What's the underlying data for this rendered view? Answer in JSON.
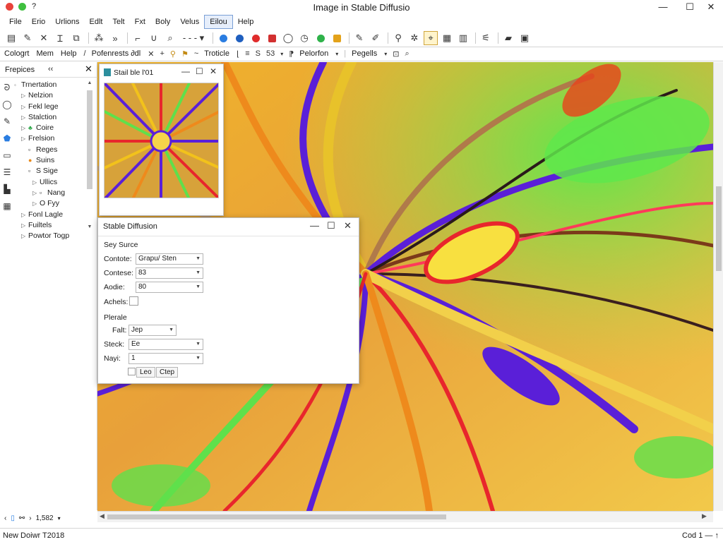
{
  "window": {
    "title": "Image in Stable Diffusio",
    "help_glyph": "?",
    "minimize": "—",
    "maximize": "☐",
    "close": "✕"
  },
  "menu": [
    "File",
    "Erio",
    "Urlions",
    "Edlt",
    "Telt",
    "Fxt",
    "Boly",
    "Velus",
    "Eilou",
    "Help"
  ],
  "toolbar2": {
    "items": [
      "Cologrt",
      "Mem",
      "Help",
      "Pofenrests ∂dl",
      "Troticle",
      "Pelorfon",
      "Pegells"
    ],
    "num_s": "S",
    "num_53": "53"
  },
  "left_panel": {
    "title": "Frepices",
    "collapse": "‹‹",
    "close": "✕",
    "tree": [
      {
        "label": "Trnertation",
        "arrow": "◦",
        "icon": ""
      },
      {
        "label": "Nelzion",
        "arrow": "▷",
        "icon": ""
      },
      {
        "label": "Fekl lege",
        "arrow": "▷",
        "icon": ""
      },
      {
        "label": "Stalction",
        "arrow": "▷",
        "icon": ""
      },
      {
        "label": "Coire",
        "arrow": "▷",
        "icon": "♣"
      },
      {
        "label": "Frelsion",
        "arrow": "▷",
        "icon": ""
      },
      {
        "label": "Reges",
        "arrow": "",
        "icon": "▫"
      },
      {
        "label": "Suins",
        "arrow": "",
        "icon": "●"
      },
      {
        "label": "S Sige",
        "arrow": "",
        "icon": "▫"
      },
      {
        "label": "Ullics",
        "arrow": "▷",
        "icon": ""
      },
      {
        "label": "Nang",
        "arrow": "▷",
        "icon": "▫"
      },
      {
        "label": "O Fyy",
        "arrow": "▷",
        "icon": ""
      },
      {
        "label": "Fonl Lagle",
        "arrow": "▷",
        "icon": ""
      },
      {
        "label": "Fuiltels",
        "arrow": "▷",
        "icon": ""
      },
      {
        "label": "Powtor Togp",
        "arrow": "▷",
        "icon": ""
      }
    ]
  },
  "preview_window": {
    "title": "Stail ble l'01"
  },
  "dialog": {
    "title": "Stable Diffusion",
    "section1": "Sey Surce",
    "fields": [
      {
        "label": "Contote:",
        "value": "Grapu/ Sten"
      },
      {
        "label": "Contese:",
        "value": "83"
      },
      {
        "label": "Aodie:",
        "value": "80"
      }
    ],
    "checkbox_label": "Achels:",
    "section2": "Plerale",
    "fields2": [
      {
        "label": "Falt:",
        "value": "Jep"
      },
      {
        "label": "Steck:",
        "value": "Ee"
      },
      {
        "label": "Nayi:",
        "value": "1"
      }
    ],
    "button1": "Leo",
    "button2": "Ctep"
  },
  "bottom_left": {
    "zoom": "1,582"
  },
  "status": {
    "left": "New Doiwr T2018",
    "right": "Cod 1 — ↑"
  },
  "colors": {
    "accent": "#7a9fd6",
    "purple": "#5a1fd8",
    "yellow": "#f2c21b",
    "green": "#5fe04b",
    "red": "#e8262c",
    "orange": "#ee8a1c"
  }
}
